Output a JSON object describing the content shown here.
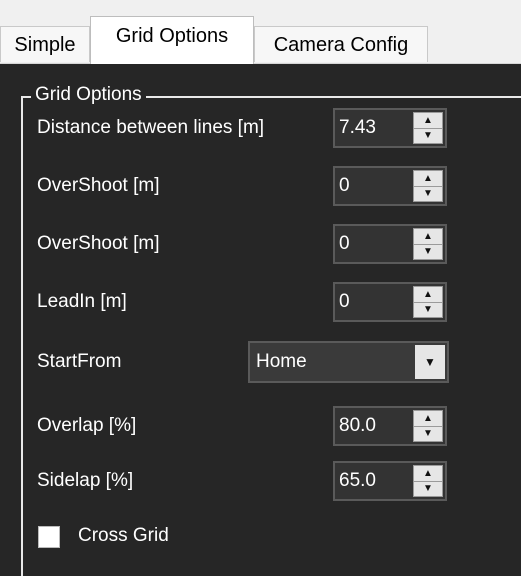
{
  "tabs": [
    "Simple",
    "Grid Options",
    "Camera Config"
  ],
  "group": {
    "title": "Grid Options",
    "fields": {
      "distance": {
        "label": "Distance between lines [m]",
        "value": "7.43"
      },
      "overshoot1": {
        "label": "OverShoot [m]",
        "value": "0"
      },
      "overshoot2": {
        "label": "OverShoot [m]",
        "value": "0"
      },
      "leadin": {
        "label": "LeadIn [m]",
        "value": "0"
      },
      "startfrom": {
        "label": "StartFrom",
        "value": "Home"
      },
      "overlap": {
        "label": "Overlap [%]",
        "value": "80.0"
      },
      "sidelap": {
        "label": "Sidelap [%]",
        "value": "65.0"
      }
    },
    "cross_grid": {
      "label": "Cross Grid",
      "checked": false
    }
  },
  "icons": {
    "spin_up": "▲",
    "spin_down": "▼",
    "dropdown": "▼"
  }
}
